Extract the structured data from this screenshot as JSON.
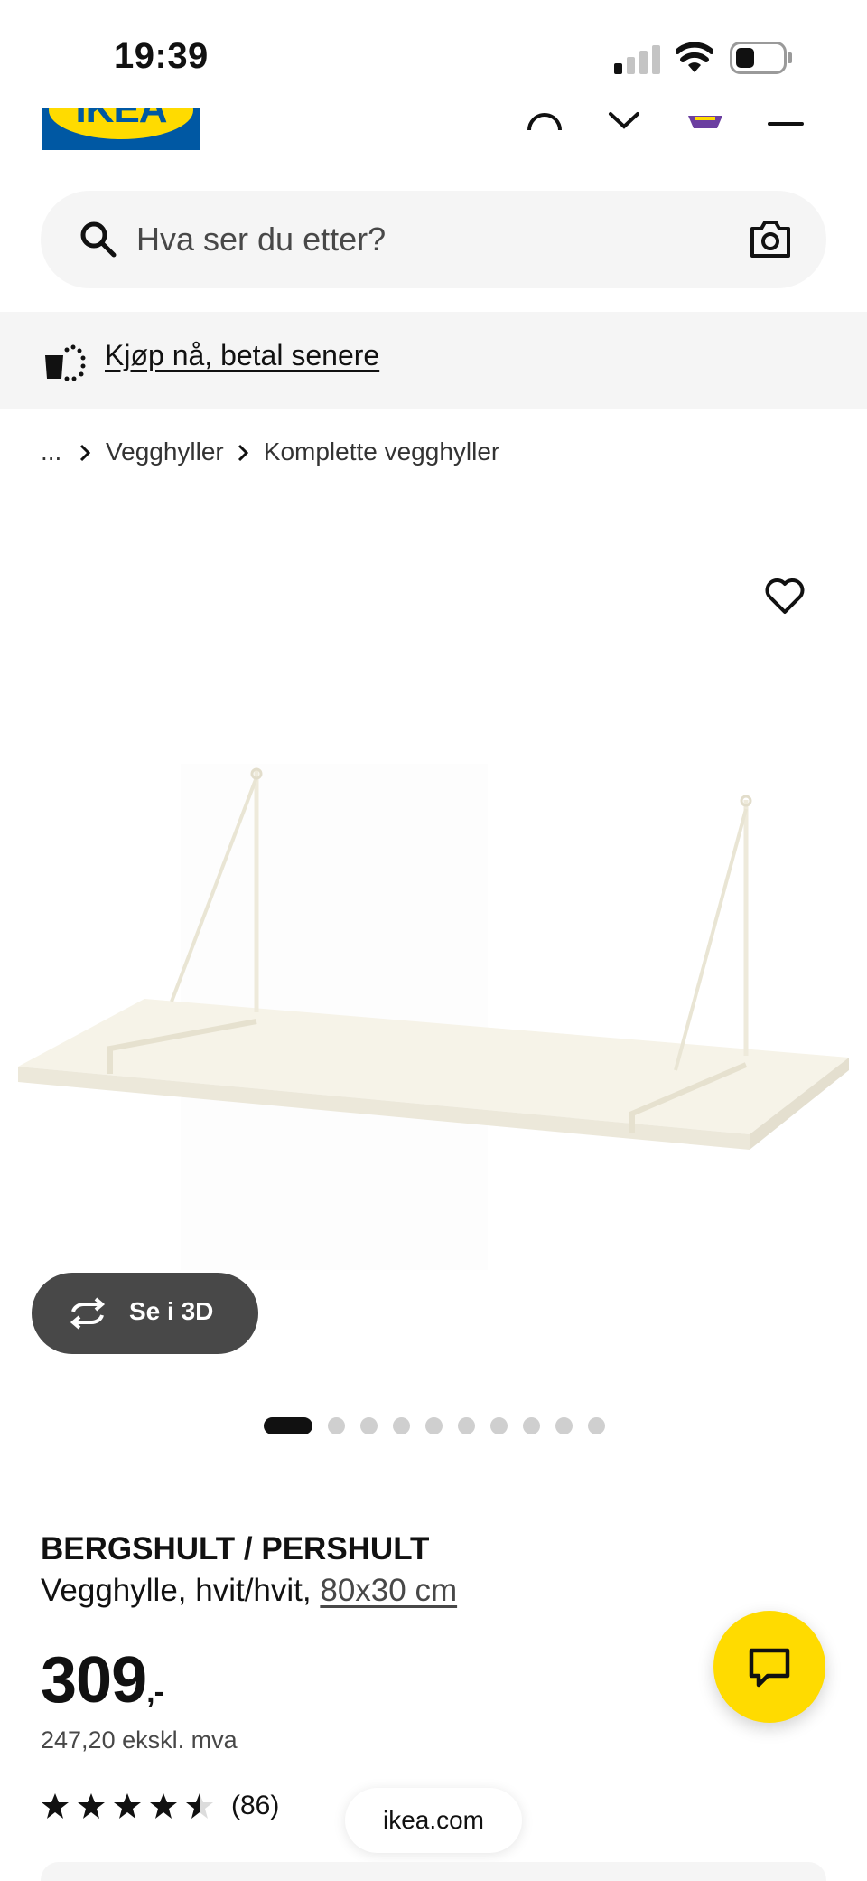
{
  "status_bar": {
    "time": "19:39"
  },
  "header": {
    "logo_text": "IKEA"
  },
  "search": {
    "placeholder": "Hva ser du etter?"
  },
  "banner": {
    "link_label": "Kjøp nå, betal senere"
  },
  "breadcrumb": {
    "ellipsis": "...",
    "items": [
      "Vegghyller",
      "Komplette vegghyller"
    ]
  },
  "gallery": {
    "view_3d_label": "Se i 3D",
    "image_count": 10,
    "active_index": 0
  },
  "product": {
    "name": "BERGSHULT / PERSHULT",
    "description": "Vegghylle, hvit/hvit,",
    "size": "80x30 cm",
    "price": "309",
    "price_suffix": ",-",
    "price_ex_vat": "247,20 ekskl. mva",
    "rating": 4.5,
    "rating_count": "(86)"
  },
  "browser": {
    "url": "ikea.com"
  },
  "colors": {
    "brand_blue": "#0058a3",
    "brand_yellow": "#ffdb00",
    "dark_gray": "#484848"
  }
}
